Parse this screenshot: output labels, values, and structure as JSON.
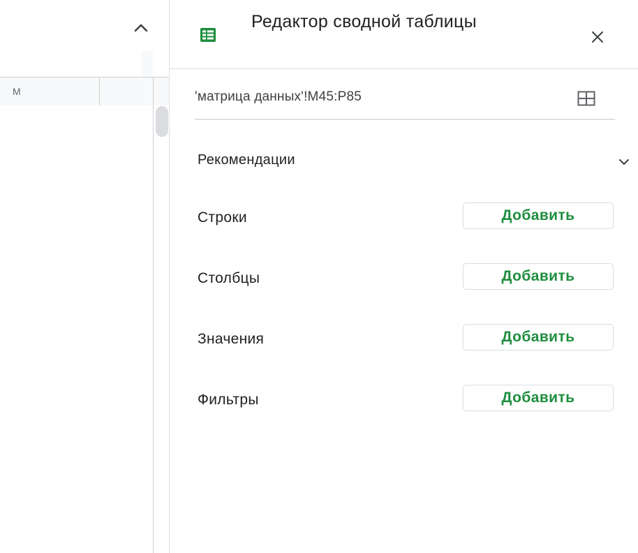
{
  "sheet": {
    "column_headers": [
      "M",
      ""
    ],
    "collapse_icon": "chevron-up-icon"
  },
  "panel": {
    "title": "Редактор сводной таблицы",
    "icon": "sheets-pivot-icon",
    "accent_color": "#1e8e3e",
    "close_icon": "close-icon",
    "data_range": "'матрица данных'!M45:P85",
    "range_icon": "grid-select-icon",
    "recommendations_label": "Рекомендации",
    "recommendations_icon": "chevron-down-icon",
    "sections": [
      {
        "label": "Строки",
        "button": "Добавить"
      },
      {
        "label": "Столбцы",
        "button": "Добавить"
      },
      {
        "label": "Значения",
        "button": "Добавить"
      },
      {
        "label": "Фильтры",
        "button": "Добавить"
      }
    ]
  }
}
